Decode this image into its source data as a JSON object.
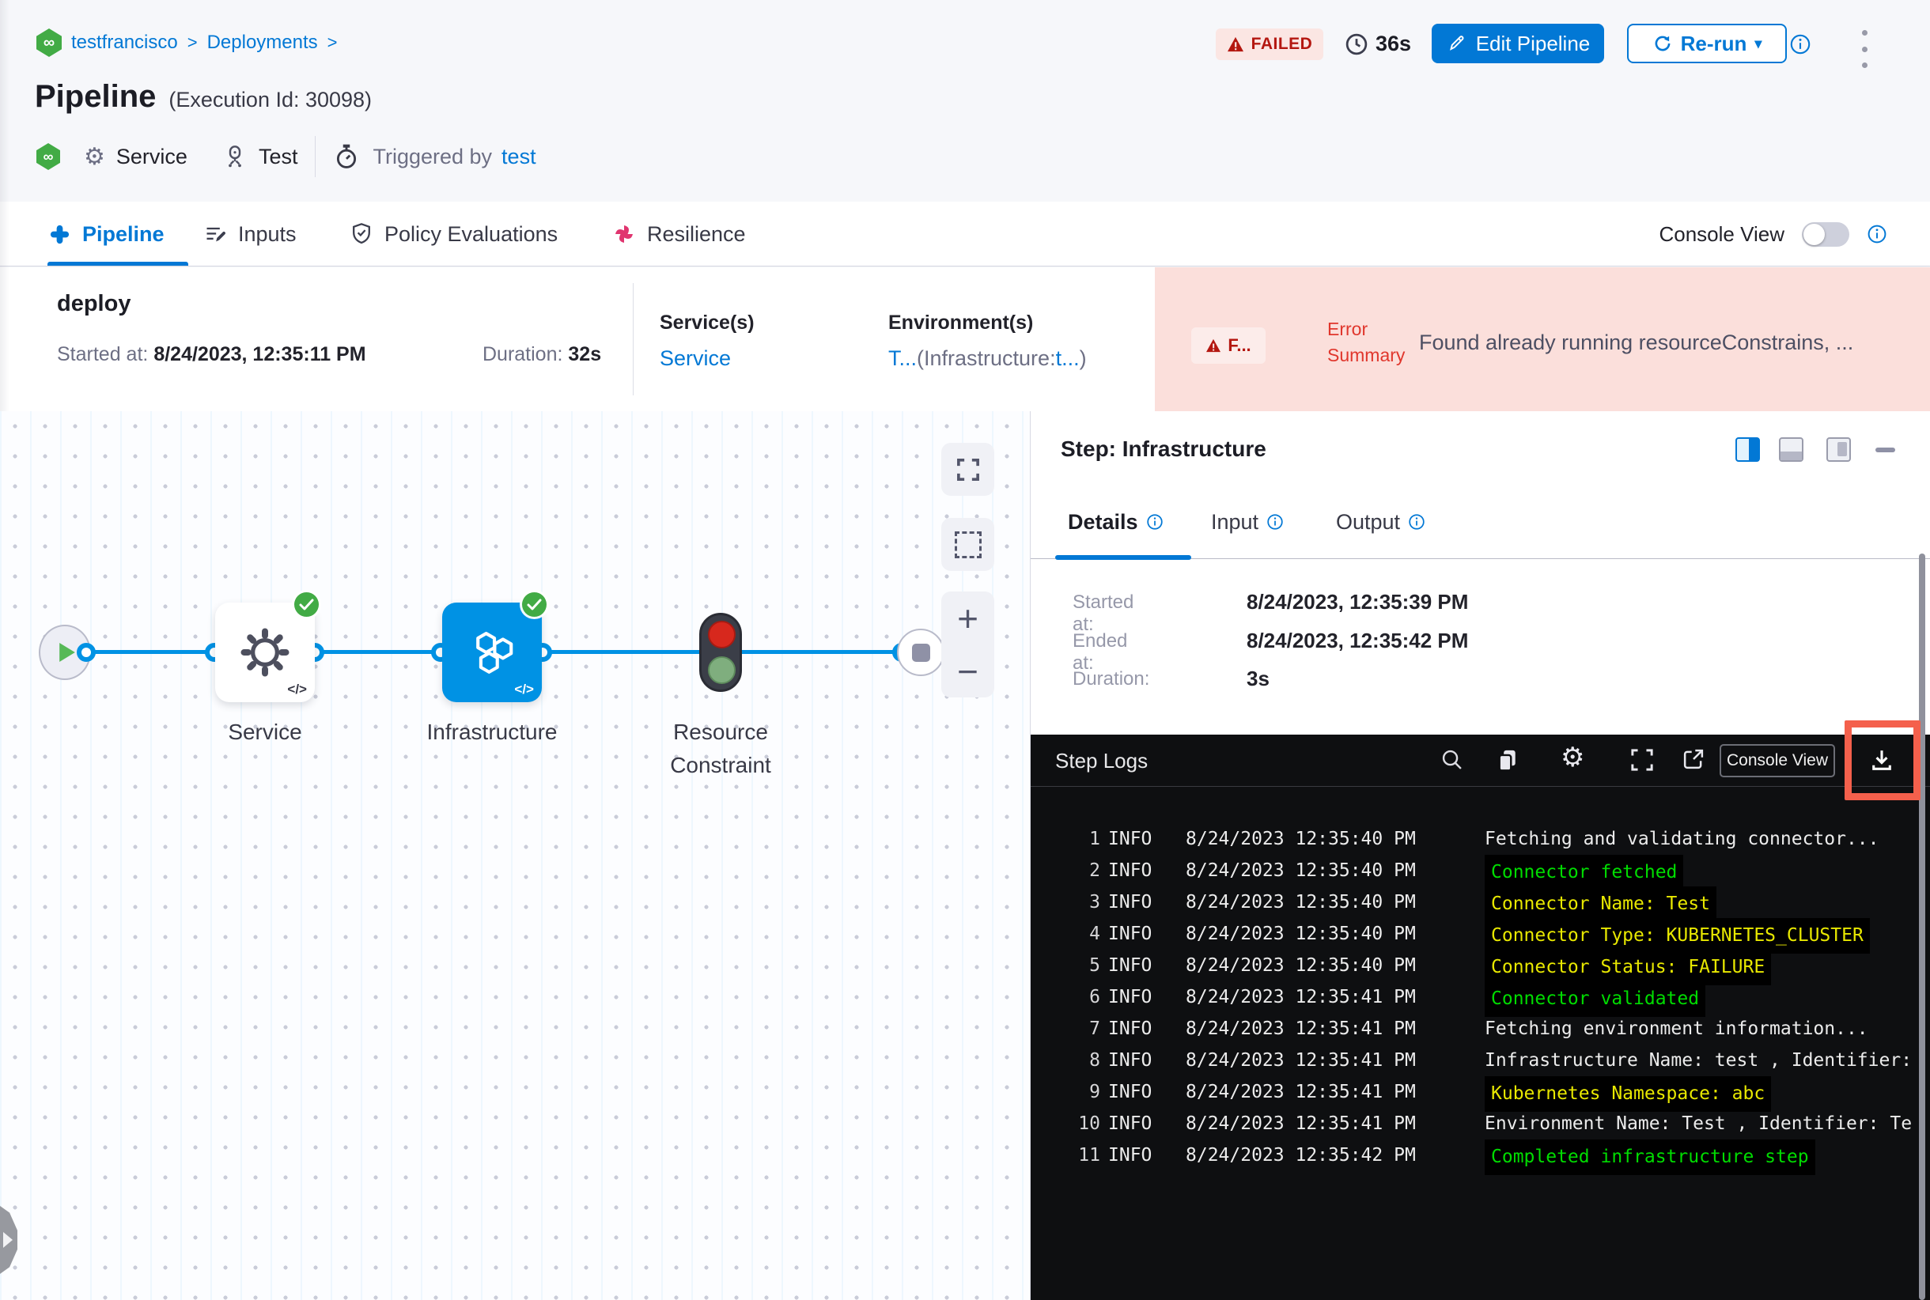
{
  "breadcrumb": {
    "org": "testfrancisco",
    "section": "Deployments",
    "sep": ">"
  },
  "header": {
    "status": "FAILED",
    "elapsed": "36s",
    "edit_button": "Edit Pipeline",
    "rerun_button": "Re-run",
    "title": "Pipeline",
    "execution_id": "(Execution Id: 30098)",
    "service": "Service",
    "environment": "Test",
    "triggered_by_label": "Triggered by",
    "triggered_by_user": "test"
  },
  "tabs": {
    "pipeline": "Pipeline",
    "inputs": "Inputs",
    "policy": "Policy Evaluations",
    "resilience": "Resilience",
    "console_view": "Console View"
  },
  "summary": {
    "stage": "deploy",
    "started_label": "Started at:",
    "started": "8/24/2023, 12:35:11 PM",
    "duration_label": "Duration:",
    "duration": "32s",
    "services_label": "Service(s)",
    "services_value": "Service",
    "environments_label": "Environment(s)",
    "env_link_1": "T...",
    "env_mid": "(Infrastructure:",
    "env_link_2": "t...",
    "env_end": ")",
    "error_badge": "F...",
    "error_label_line1": "Error",
    "error_label_line2": "Summary",
    "error_text": "Found already running resourceConstrains, ..."
  },
  "graph": {
    "node1": "Service",
    "node2": "Infrastructure",
    "node3_line1": "Resource",
    "node3_line2": "Constraint"
  },
  "panel": {
    "title": "Step: Infrastructure",
    "tab_details": "Details",
    "tab_input": "Input",
    "tab_output": "Output",
    "started_label": "Started at:",
    "started": "8/24/2023, 12:35:39 PM",
    "ended_label": "Ended at:",
    "ended": "8/24/2023, 12:35:42 PM",
    "duration_label": "Duration:",
    "duration": "3s"
  },
  "logs": {
    "title": "Step Logs",
    "console_view": "Console View",
    "lines": [
      {
        "num": 1,
        "level": "INFO",
        "time": "8/24/2023 12:35:40 PM",
        "msg": "Fetching and validating connector...",
        "color": "white"
      },
      {
        "num": 2,
        "level": "INFO",
        "time": "8/24/2023 12:35:40 PM",
        "msg": "Connector fetched",
        "color": "green"
      },
      {
        "num": 3,
        "level": "INFO",
        "time": "8/24/2023 12:35:40 PM",
        "msg": "Connector Name: Test",
        "color": "yellow"
      },
      {
        "num": 4,
        "level": "INFO",
        "time": "8/24/2023 12:35:40 PM",
        "msg": "Connector Type: KUBERNETES_CLUSTER",
        "color": "yellow"
      },
      {
        "num": 5,
        "level": "INFO",
        "time": "8/24/2023 12:35:40 PM",
        "msg": "Connector Status: FAILURE",
        "color": "yellow"
      },
      {
        "num": 6,
        "level": "INFO",
        "time": "8/24/2023 12:35:41 PM",
        "msg": "Connector validated",
        "color": "green"
      },
      {
        "num": 7,
        "level": "INFO",
        "time": "8/24/2023 12:35:41 PM",
        "msg": "Fetching environment information...",
        "color": "white"
      },
      {
        "num": 8,
        "level": "INFO",
        "time": "8/24/2023 12:35:41 PM",
        "msg": "Infrastructure Name: test , Identifier:",
        "color": "white"
      },
      {
        "num": 9,
        "level": "INFO",
        "time": "8/24/2023 12:35:41 PM",
        "msg": "Kubernetes Namespace: abc",
        "color": "yellow"
      },
      {
        "num": 10,
        "level": "INFO",
        "time": "8/24/2023 12:35:41 PM",
        "msg": "Environment Name: Test , Identifier: Te",
        "color": "white"
      },
      {
        "num": 11,
        "level": "INFO",
        "time": "8/24/2023 12:35:42 PM",
        "msg": "Completed infrastructure step",
        "color": "green"
      }
    ]
  },
  "icons": {
    "infinity": "∞",
    "gear": "⚙",
    "caret_down": "▾",
    "plus": "+",
    "minus": "−",
    "code": "</>"
  },
  "colors": {
    "accent_blue": "#0278d5",
    "node_blue": "#0092e4",
    "success_green": "#42ab45",
    "failed_red": "#b41710",
    "error_pink_bg": "#fbdfdb",
    "log_white": "#ececec",
    "log_green": "#00dc00",
    "log_yellow": "#e8e800",
    "highlight_red": "#f4604c"
  }
}
